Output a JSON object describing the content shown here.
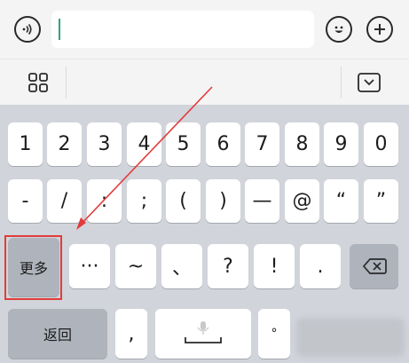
{
  "input_bar": {
    "voice_icon": "voice-icon",
    "emoji_icon": "emoji-icon",
    "plus_icon": "plus-icon",
    "text_value": ""
  },
  "toolbar": {
    "grid_icon": "grid-icon",
    "collapse_icon": "keyboard-collapse-icon"
  },
  "keyboard": {
    "row1": [
      "1",
      "2",
      "3",
      "4",
      "5",
      "6",
      "7",
      "8",
      "9",
      "0"
    ],
    "row2": [
      "-",
      "/",
      ":",
      ";",
      "(",
      ")",
      "—",
      "@",
      "“",
      "”"
    ],
    "row3": {
      "more": "更多",
      "keys": [
        "···",
        "~",
        "、",
        "?",
        "!",
        "."
      ],
      "delete_icon": "backspace-icon"
    },
    "row4": {
      "back": "返回",
      "comma": ",",
      "mic_icon": "microphone-icon",
      "degree": "°"
    }
  },
  "annotation": {
    "color": "#e23b3b"
  }
}
